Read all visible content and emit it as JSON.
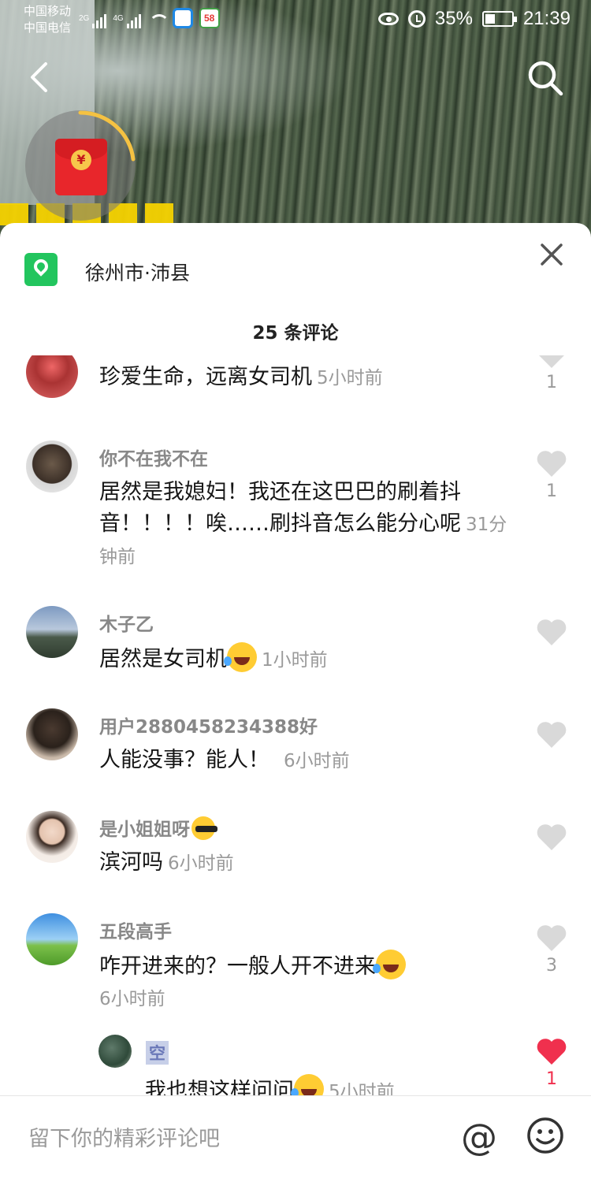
{
  "status_bar": {
    "carrier_1": "中国移动",
    "carrier_2": "中国电信",
    "signal_1_label": "2G",
    "signal_2_label": "4G",
    "app_icon_label": "58",
    "battery": "35%",
    "time": "21:39"
  },
  "redpacket_symbol": "¥",
  "sheet": {
    "location": "徐州市·沛县",
    "comment_count": "25 条评论"
  },
  "comments": [
    {
      "nick": "",
      "text": "珍爱生命，远离女司机",
      "time": "5小时前",
      "likes": "1",
      "liked": false
    },
    {
      "nick": "你不在我不在",
      "text": "居然是我媳妇！我还在这巴巴的刷着抖音！！！！唉……刷抖音怎么能分心呢",
      "time": "31分钟前",
      "likes": "1",
      "liked": false
    },
    {
      "nick": "木子乙",
      "text": "居然是女司机",
      "emoji": "laugh",
      "time": "1小时前",
      "likes": "",
      "liked": false
    },
    {
      "nick": "用户2880458234388好",
      "text": "人能没事？能人！",
      "time": "6小时前",
      "likes": "",
      "liked": false
    },
    {
      "nick": "是小姐姐呀",
      "nick_emoji": "cool",
      "text": "滨河吗",
      "time": "6小时前",
      "likes": "",
      "liked": false
    },
    {
      "nick": "五段高手",
      "text": "咋开进来的？一般人开不进来",
      "emoji": "laugh",
      "time": "6小时前",
      "likes": "3",
      "liked": false
    }
  ],
  "reply": {
    "nick": "空",
    "text": "我也想这样问问",
    "emoji": "laugh",
    "time": "5小时前",
    "likes": "1",
    "liked": true
  },
  "input": {
    "placeholder": "留下你的精彩评论吧",
    "at_symbol": "@"
  },
  "colors": {
    "liked": "#f0304e",
    "unliked": "#d9d9d9",
    "location_green": "#22c55e"
  }
}
